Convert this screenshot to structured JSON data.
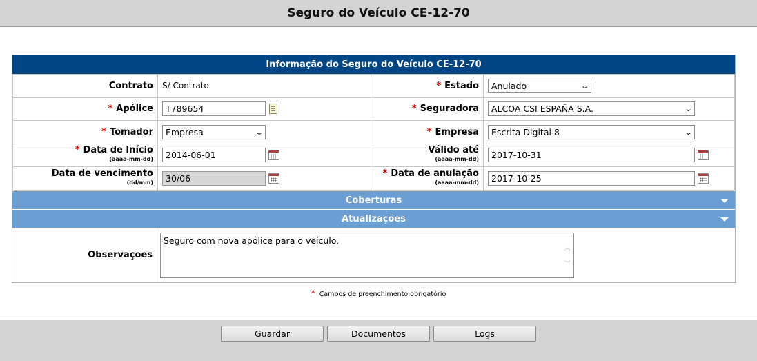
{
  "page": {
    "title": "Seguro do Veículo CE-12-70"
  },
  "panel": {
    "header": "Informação do Seguro do Veículo CE-12-70"
  },
  "form": {
    "contrato": {
      "label": "Contrato",
      "value": "S/ Contrato"
    },
    "estado": {
      "label": "Estado",
      "value": "Anulado"
    },
    "apolice": {
      "label": "Apólice",
      "value": "T789654"
    },
    "seguradora": {
      "label": "Seguradora",
      "value": "ALCOA CSI ESPAÑA S.A."
    },
    "tomador": {
      "label": "Tomador",
      "value": "Empresa"
    },
    "empresa": {
      "label": "Empresa",
      "value": "Escrita Digital 8"
    },
    "data_inicio": {
      "label": "Data de Início",
      "hint": "(aaaa-mm-dd)",
      "value": "2014-06-01"
    },
    "valido_ate": {
      "label": "Válido até",
      "hint": "(aaaa-mm-dd)",
      "value": "2017-10-31"
    },
    "data_vencimento": {
      "label": "Data de vencimento",
      "hint": "(dd/mm)",
      "value": "30/06"
    },
    "data_anulacao": {
      "label": "Data de anulação",
      "hint": "(aaaa-mm-dd)",
      "value": "2017-10-25"
    },
    "required_mark": "*"
  },
  "sections": {
    "coberturas": "Coberturas",
    "atualizacoes": "Atualizações"
  },
  "observacoes": {
    "label": "Observações",
    "value": "Seguro com nova apólice para o veículo."
  },
  "legend": {
    "text": "Campos de preenchimento obrigatório"
  },
  "buttons": {
    "guardar": "Guardar",
    "documentos": "Documentos",
    "logs": "Logs"
  },
  "colors": {
    "header": "#004586",
    "section": "#6b9fd3",
    "required": "#cc0000"
  }
}
